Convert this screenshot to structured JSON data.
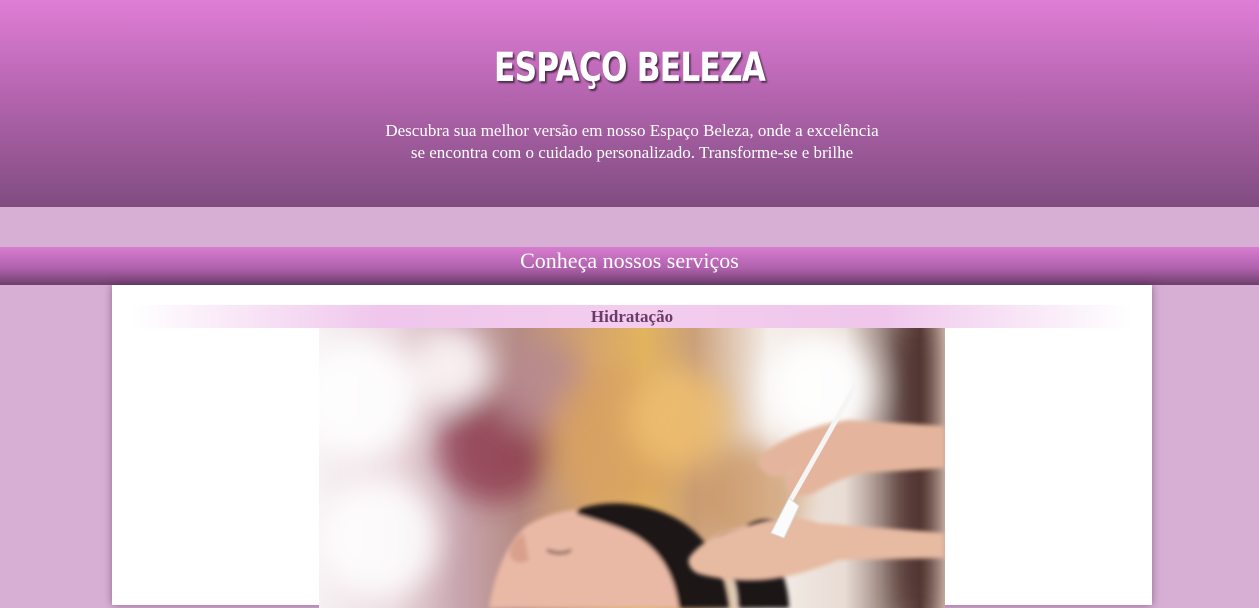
{
  "header": {
    "title": "Espaço Beleza",
    "tagline": "Descubra sua melhor versão em nosso Espaço Beleza, onde a excelência se encontra com o cuidado personalizado. Transforme-se e brilhe"
  },
  "services": {
    "heading": "Conheça nossos serviços",
    "items": [
      {
        "title": "Hidratação",
        "image": "hair-treatment-photo"
      }
    ]
  },
  "colors": {
    "header_top": "#e07ed6",
    "header_bottom": "#804c80",
    "page_background": "#d8afd4",
    "card_title_text": "#6b3a68"
  }
}
